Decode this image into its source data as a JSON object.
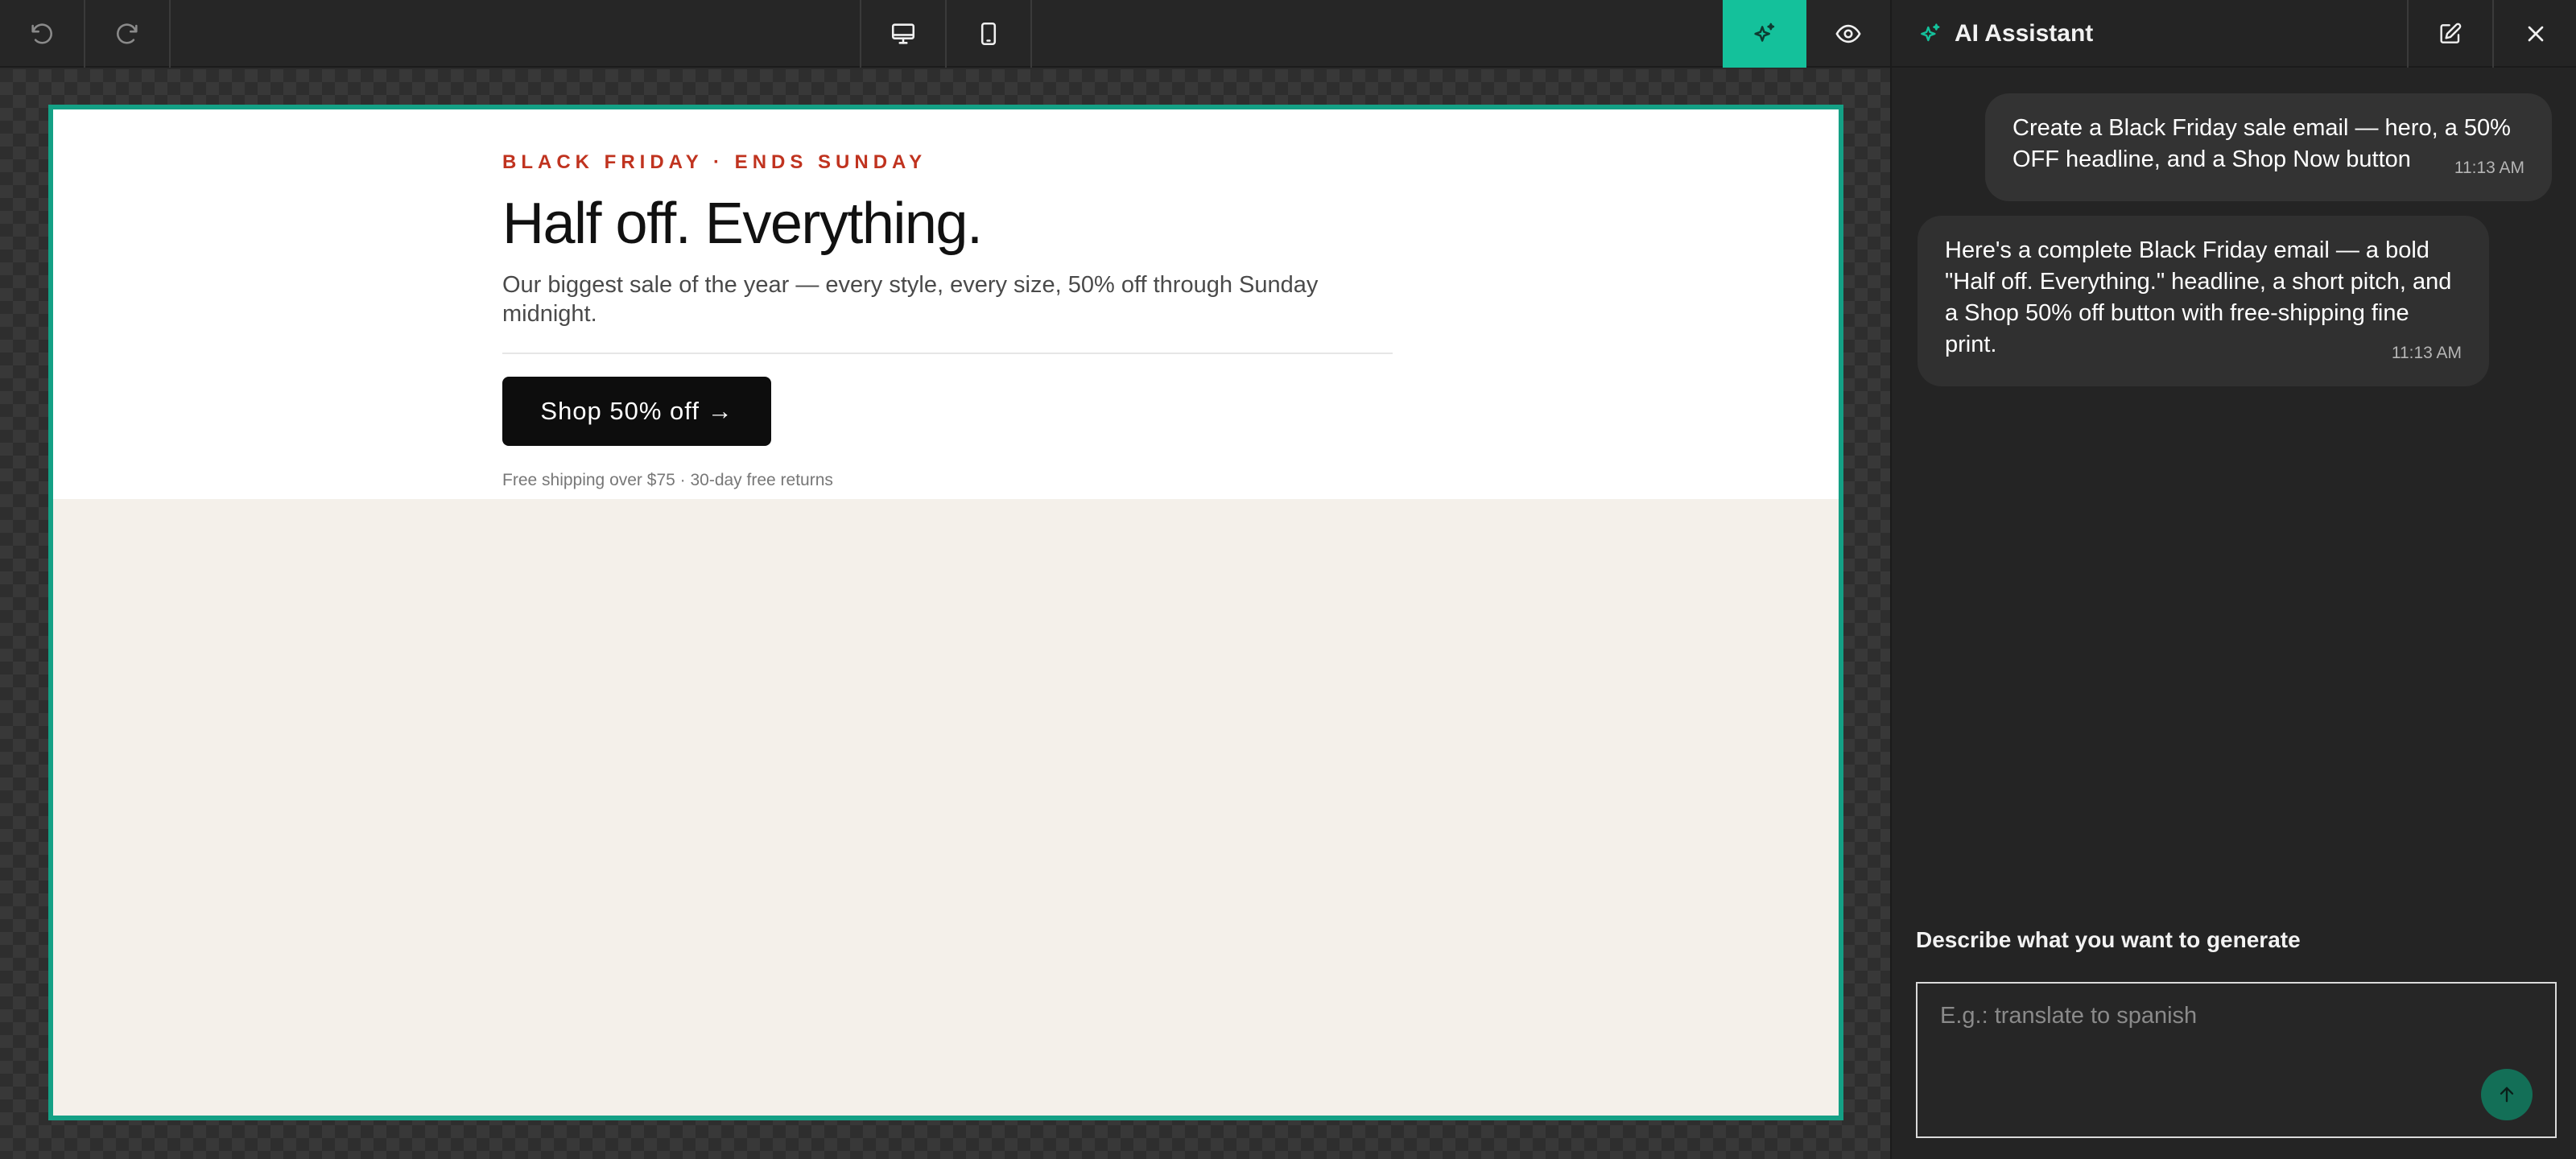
{
  "toolbar": {
    "undo_icon": "undo-icon",
    "redo_icon": "redo-icon",
    "desktop_icon": "desktop-icon",
    "mobile_icon": "mobile-icon",
    "ai_icon": "sparkle-icon",
    "preview_icon": "eye-icon",
    "accent_color": "#14c19b"
  },
  "email": {
    "eyebrow": "BLACK FRIDAY · ENDS SUNDAY",
    "headline": "Half off. Everything.",
    "subtext": "Our biggest sale of the year — every style, every size, 50% off through Sunday midnight.",
    "button_label": "Shop 50% off →",
    "fine_print": "Free shipping over $75 · 30-day free returns",
    "eyebrow_color": "#c0331f",
    "frame_color": "#14a085"
  },
  "panel": {
    "title": "AI Assistant",
    "new_chat_icon": "edit-icon",
    "close_icon": "close-icon",
    "messages": [
      {
        "role": "user",
        "text": "Create a Black Friday sale email — hero, a 50% OFF headline, and a Shop Now button",
        "time": "11:13 AM"
      },
      {
        "role": "assistant",
        "text": "Here's a complete Black Friday email — a bold \"Half off. Everything.\" headline, a short pitch, and a Shop 50% off button with free-shipping fine print.",
        "time": "11:13 AM"
      }
    ],
    "prompt_label": "Describe what you want to generate",
    "prompt_placeholder": "E.g.: translate to spanish",
    "send_icon": "arrow-up-icon"
  }
}
